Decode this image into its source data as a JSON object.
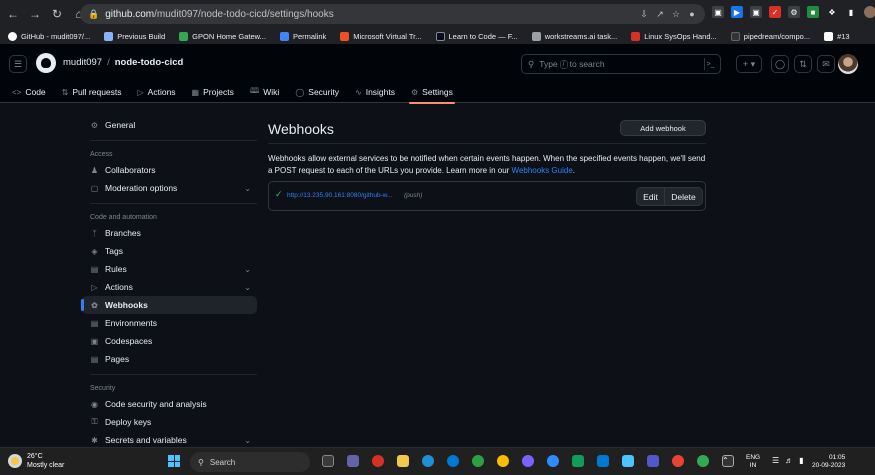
{
  "browser": {
    "url_host": "github.com",
    "url_path": "/mudit097/node-todo-cicd/settings/hooks",
    "bookmarks": [
      {
        "label": "GitHub - mudit097/...",
        "color": "#ffffff"
      },
      {
        "label": "Previous Build",
        "color": "#8ab4f8"
      },
      {
        "label": "GPON Home Gatew...",
        "color": "#34a853"
      },
      {
        "label": "Permalink",
        "color": "#4285f4"
      },
      {
        "label": "Microsoft Virtual Tr...",
        "color": "#f25022"
      },
      {
        "label": "Learn to Code — F...",
        "color": "#0a0a23"
      },
      {
        "label": "workstreams.ai task...",
        "color": "#9aa0a6"
      },
      {
        "label": "Linux SysOps Hand...",
        "color": "#d93025"
      },
      {
        "label": "pipedream/compo...",
        "color": "#333333"
      },
      {
        "label": "#13",
        "color": "#ffffff"
      }
    ]
  },
  "header": {
    "owner": "mudit097",
    "separator": "/",
    "repo": "node-todo-cicd",
    "search_placeholder_pre": "Type",
    "search_slash": "/",
    "search_placeholder_post": "to search"
  },
  "repo_nav": {
    "tabs": [
      {
        "label": "Code",
        "icon": "code-icon"
      },
      {
        "label": "Pull requests",
        "icon": "pull-request-icon"
      },
      {
        "label": "Actions",
        "icon": "play-icon"
      },
      {
        "label": "Projects",
        "icon": "table-icon"
      },
      {
        "label": "Wiki",
        "icon": "book-icon"
      },
      {
        "label": "Security",
        "icon": "shield-icon"
      },
      {
        "label": "Insights",
        "icon": "graph-icon"
      },
      {
        "label": "Settings",
        "icon": "gear-icon",
        "active": true
      }
    ]
  },
  "sidebar": {
    "general": "General",
    "access_heading": "Access",
    "collaborators": "Collaborators",
    "moderation": "Moderation options",
    "code_heading": "Code and automation",
    "branches": "Branches",
    "tags": "Tags",
    "rules": "Rules",
    "actions": "Actions",
    "webhooks": "Webhooks",
    "environments": "Environments",
    "codespaces": "Codespaces",
    "pages": "Pages",
    "security_heading": "Security",
    "code_security": "Code security and analysis",
    "deploy_keys": "Deploy keys",
    "secrets": "Secrets and variables"
  },
  "main": {
    "title": "Webhooks",
    "add_button": "Add webhook",
    "description_1": "Webhooks allow external services to be notified when certain events happen. When the specified events happen, we'll send a POST request to each of the URLs you provide. Learn more in our ",
    "guide_link": "Webhooks Guide",
    "description_2": ".",
    "webhook": {
      "url": "http://13.235.90.161:8080/github-w...",
      "events": "(push)",
      "status_color": "#3fb950",
      "edit_label": "Edit",
      "delete_label": "Delete"
    }
  },
  "taskbar": {
    "temperature": "26°C",
    "weather": "Mostly clear",
    "search_label": "Search",
    "lang_1": "ENG",
    "lang_2": "IN",
    "time": "01:05",
    "date": "20-09-2023"
  }
}
